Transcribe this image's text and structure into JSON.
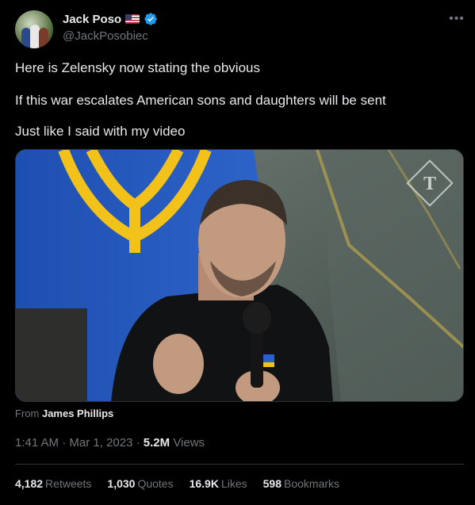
{
  "author": {
    "display_name": "Jack Poso",
    "handle": "@JackPosobiec",
    "flag_icon": "us-flag-icon",
    "verified_icon": "verified-badge-icon",
    "verified_color": "#1d9bf0"
  },
  "tweet": {
    "lines": [
      "Here is Zelensky now stating the obvious",
      "If this war escalates American sons and daughters will be sent",
      "Just like I said with my video"
    ]
  },
  "media": {
    "from_prefix": "From",
    "from_name": "James Phillips",
    "watermark_icon": "telegraph-logo-icon"
  },
  "meta": {
    "time": "1:41 AM",
    "separator": "·",
    "date": "Mar 1, 2023",
    "views_count": "5.2M",
    "views_label": "Views"
  },
  "stats": [
    {
      "count": "4,182",
      "label": "Retweets"
    },
    {
      "count": "1,030",
      "label": "Quotes"
    },
    {
      "count": "16.9K",
      "label": "Likes"
    },
    {
      "count": "598",
      "label": "Bookmarks"
    }
  ],
  "colors": {
    "background": "#000000",
    "text": "#e7e9ea",
    "muted": "#71767b",
    "border": "#2f3336"
  }
}
